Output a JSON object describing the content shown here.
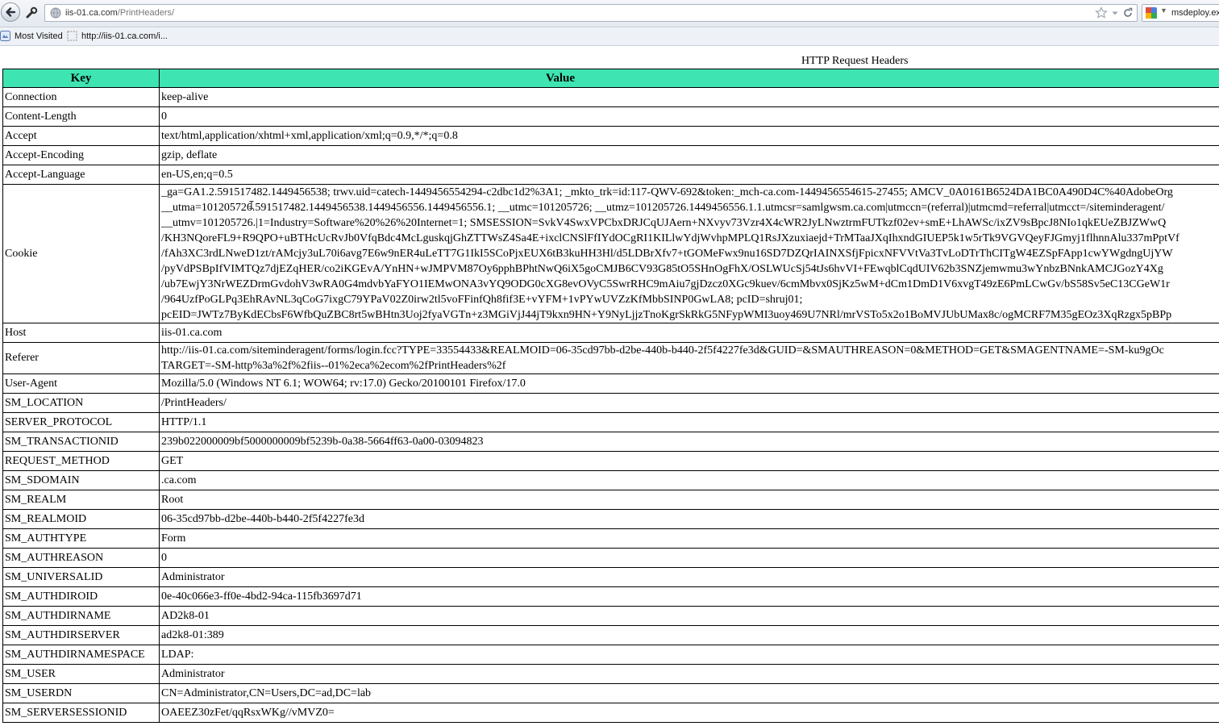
{
  "browser": {
    "url_host": "iis-01.ca.com",
    "url_path": "/PrintHeaders/",
    "search_text": "msdeploy.exe",
    "bookmarks": [
      {
        "label": "Most Visited",
        "icon": "bookmarks-icon"
      },
      {
        "label": "http://iis-01.ca.com/i...",
        "icon": "page-icon"
      }
    ]
  },
  "page": {
    "caption": "HTTP Request Headers",
    "col_key": "Key",
    "col_value": "Value",
    "rows": [
      {
        "key": "Connection",
        "value": "keep-alive"
      },
      {
        "key": "Content-Length",
        "value": "0"
      },
      {
        "key": "Accept",
        "value": "text/html,application/xhtml+xml,application/xml;q=0.9,*/*;q=0.8"
      },
      {
        "key": "Accept-Encoding",
        "value": "gzip, deflate"
      },
      {
        "key": "Accept-Language",
        "value": "en-US,en;q=0.5"
      },
      {
        "key": "Cookie",
        "lines": [
          "_ga=GA1.2.591517482.1449456538; trwv.uid=catech-1449456554294-c2dbc1d2%3A1; _mkto_trk=id:117-QWV-692&token:_mch-ca.com-1449456554615-27455; AMCV_0A0161B6524DA1BC0A490D4C%40AdobeOrg",
          "__utma=101205726.591517482.1449456538.1449456556.1449456556.1; __utmc=101205726; __utmz=101205726.1449456556.1.1.utmcsr=samlgwsm.ca.com|utmccn=(referral)|utmcmd=referral|utmcct=/siteminderagent/",
          "__utmv=101205726.|1=Industry=Software%20%26%20Internet=1; SMSESSION=SvkV4SwxVPCbxDRJCqUJAern+NXvyv73Vzr4X4cWR2JyLNwztrmFUTkzf02ev+smE+LhAWSc/ixZV9sBpcJ8NIo1qkEUeZBJZWwQ",
          "/KH3NQoreFL9+R9QPO+uBTHcUcRvJb0VfqBdc4McLguskqjGhZTTWsZ4Sa4E+ixclCNSlFfIYdOCgRI1KILlwYdjWvhpMPLQ1RsJXzuxiaejd+TrMTaaJXqIhxndGIUEP5k1w5rTk9VGVQeyFJGmyj1flhnnAlu337mPptVf",
          "/fAh3XC3rdLNweD1zt/rAMcjy3uL70i6avg7E6w9nER4uLeTT7G1IkI5SCoPjxEUX6tB3kuHH3Hl/d5LDBrXfv7+tGOMeFwx9nu16SD7DZQrIAINXSfjFpicxNFVVtVa3TvLoDTrThCITgW4EZSpFApp1cwYWgdngUjYW",
          "/pyVdPSBpIfVIMTQz7djEZqHER/co2iKGEvA/YnHN+wJMPVM87Oy6pphBPhtNwQ6iX5goCMJB6CV93G85tO5SHnOgFhX/OSLWUcSj54tJs6hvVI+FEwqblCqdUIV62b3SNZjemwmu3wYnbzBNnkAMCJGozY4Xg",
          "/ub7EwjY3NrWEZDrmGvdohV3wRA0G4mdvbYaFYO1IEMwONA3vYQ9ODG0cXG8evOVyC5SwrRHC9mAiu7gjDzcz0XGc9kuev/6cmMbvx0SjKz5wM+dCm1DmD1V6xvgT49zE6PmLCwGv/bS58Sv5eC13CGeW1r",
          "/964UzfPoGLPq3EhRAvNL3qCoG7ixgC79YPaV02Z0irw2tl5voFFinfQh8fif3E+vYFM+1vPYwUVZzKfMbbSINP0GwLA8; pcID=shruj01;",
          "pcEID=JWTz7ByKdECbsF6WfbQuZBC8rt5wBHtn3Uoj2fyaVGTn+z3MGiVjJ44jT9kxn9HN+Y9NyLjjzTnoKgrSkRkG5NFypWMI3uoy469U7NRl/mrVSTo5x2o1BoMVJUbUMax8c/ogMCRF7M35gEOz3XqRzgx5pBPp"
        ]
      },
      {
        "key": "Host",
        "value": "iis-01.ca.com"
      },
      {
        "key": "Referer",
        "lines": [
          "http://iis-01.ca.com/siteminderagent/forms/login.fcc?TYPE=33554433&REALMOID=06-35cd97bb-d2be-440b-b440-2f5f4227fe3d&GUID=&SMAUTHREASON=0&METHOD=GET&SMAGENTNAME=-SM-ku9gOc",
          "TARGET=-SM-http%3a%2f%2fiis--01%2eca%2ecom%2fPrintHeaders%2f"
        ]
      },
      {
        "key": "User-Agent",
        "value": "Mozilla/5.0 (Windows NT 6.1; WOW64; rv:17.0) Gecko/20100101 Firefox/17.0"
      },
      {
        "key": "SM_LOCATION",
        "value": "/PrintHeaders/"
      },
      {
        "key": "SERVER_PROTOCOL",
        "value": "HTTP/1.1"
      },
      {
        "key": "SM_TRANSACTIONID",
        "value": "239b022000009bf5000000009bf5239b-0a38-5664ff63-0a00-03094823"
      },
      {
        "key": "REQUEST_METHOD",
        "value": "GET"
      },
      {
        "key": "SM_SDOMAIN",
        "value": ".ca.com"
      },
      {
        "key": "SM_REALM",
        "value": "Root"
      },
      {
        "key": "SM_REALMOID",
        "value": "06-35cd97bb-d2be-440b-b440-2f5f4227fe3d"
      },
      {
        "key": "SM_AUTHTYPE",
        "value": "Form"
      },
      {
        "key": "SM_AUTHREASON",
        "value": "0"
      },
      {
        "key": "SM_UNIVERSALID",
        "value": "Administrator"
      },
      {
        "key": "SM_AUTHDIROID",
        "value": "0e-40c066e3-ff0e-4bd2-94ca-115fb3697d71"
      },
      {
        "key": "SM_AUTHDIRNAME",
        "value": "AD2k8-01"
      },
      {
        "key": "SM_AUTHDIRSERVER",
        "value": "ad2k8-01:389"
      },
      {
        "key": "SM_AUTHDIRNAMESPACE",
        "value": "LDAP:"
      },
      {
        "key": "SM_USER",
        "value": "Administrator"
      },
      {
        "key": "SM_USERDN",
        "value": "CN=Administrator,CN=Users,DC=ad,DC=lab"
      },
      {
        "key": "SM_SERVERSESSIONID",
        "value": "OAEEZ30zFet/qqRsxWKg//vMVZ0="
      }
    ]
  }
}
